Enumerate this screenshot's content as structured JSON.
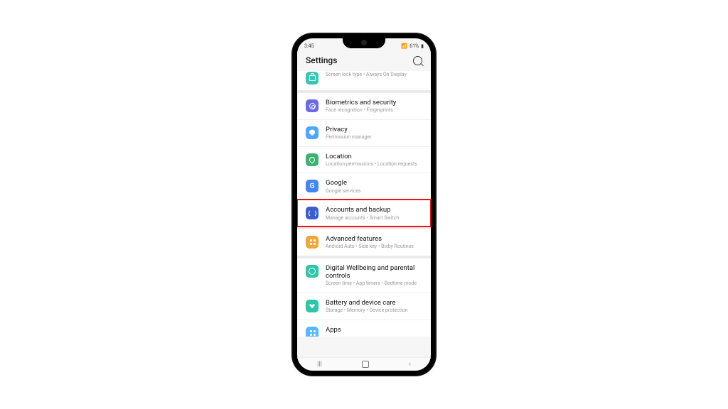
{
  "status": {
    "time": "3:45",
    "battery": "61%"
  },
  "header": {
    "title": "Settings"
  },
  "groups": [
    {
      "items": [
        {
          "name": "lock-screen",
          "icon": "lock-icon",
          "iconClass": "ic-teal",
          "glyph": "g-lock",
          "title": "",
          "subtitle": [
            "Screen lock type",
            "Always On Display"
          ],
          "partial": "top"
        }
      ]
    },
    {
      "items": [
        {
          "name": "biometrics-security",
          "icon": "fingerprint-icon",
          "iconClass": "ic-purple",
          "glyph": "g-finger",
          "title": "Biometrics and security",
          "subtitle": [
            "Face recognition",
            "Fingerprints"
          ]
        },
        {
          "name": "privacy",
          "icon": "shield-icon",
          "iconClass": "ic-blue",
          "glyph": "g-shield",
          "title": "Privacy",
          "subtitle": [
            "Permission manager"
          ]
        },
        {
          "name": "location",
          "icon": "pin-icon",
          "iconClass": "ic-green",
          "glyph": "g-pin",
          "title": "Location",
          "subtitle": [
            "Location permissions",
            "Location requests"
          ]
        },
        {
          "name": "google",
          "icon": "google-icon",
          "iconClass": "ic-gblue",
          "glyph": "",
          "letter": "G",
          "title": "Google",
          "subtitle": [
            "Google services"
          ]
        },
        {
          "name": "accounts-backup",
          "icon": "sync-icon",
          "iconClass": "ic-navy",
          "glyph": "g-sync",
          "title": "Accounts and backup",
          "subtitle": [
            "Manage accounts",
            "Smart Switch"
          ],
          "highlighted": true
        }
      ]
    },
    {
      "items": [
        {
          "name": "advanced-features",
          "icon": "grid-icon",
          "iconClass": "ic-orange",
          "glyph": "g-dots",
          "title": "Advanced features",
          "subtitle": [
            "Android Auto",
            "Side key",
            "Bixby Routines"
          ]
        }
      ]
    },
    {
      "items": [
        {
          "name": "digital-wellbeing",
          "icon": "circle-icon",
          "iconClass": "ic-teal2",
          "glyph": "g-circle",
          "title": "Digital Wellbeing and parental controls",
          "subtitle": [
            "Screen time",
            "App timers",
            "Bedtime mode"
          ]
        },
        {
          "name": "battery-device-care",
          "icon": "heart-icon",
          "iconClass": "ic-teal2",
          "glyph": "g-heart",
          "title": "Battery and device care",
          "subtitle": [
            "Storage",
            "Memory",
            "Device protection"
          ]
        },
        {
          "name": "apps",
          "icon": "apps-icon",
          "iconClass": "ic-lblue",
          "glyph": "g-dots",
          "title": "Apps",
          "subtitle": [],
          "partial": "bot"
        }
      ]
    }
  ],
  "nav": {
    "recent": "|||",
    "home": "",
    "back": "‹"
  }
}
